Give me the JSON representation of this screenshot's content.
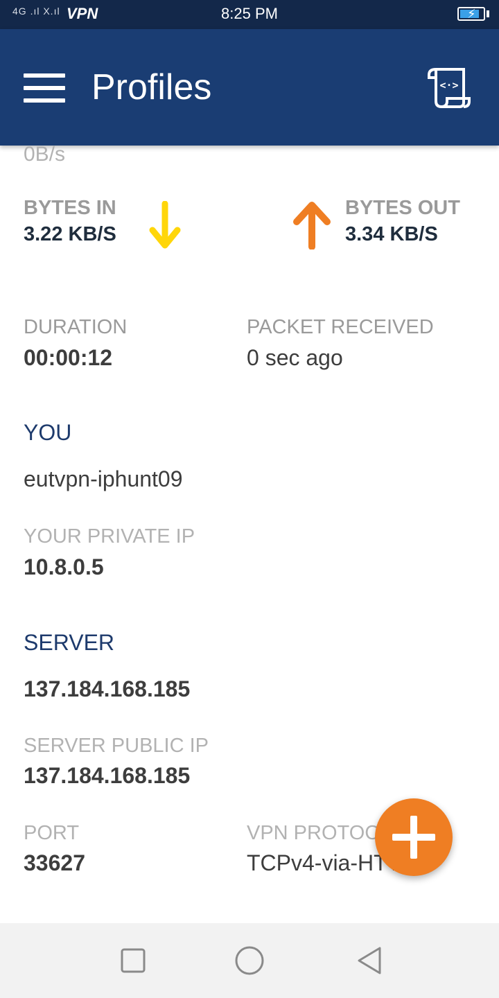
{
  "status_bar": {
    "signal_text": "4G .ıl X.ıl",
    "vpn_label": "VPN",
    "time": "8:25 PM",
    "battery_level": 0.85
  },
  "app_bar": {
    "title": "Profiles",
    "menu_icon": "hamburger-menu-icon",
    "log_icon": "log-scroll-icon"
  },
  "stats": {
    "partial_rate": "0B/s",
    "bytes_in": {
      "label": "BYTES IN",
      "value": "3.22 KB/S",
      "icon": "arrow-down-icon",
      "color": "#ffd60a"
    },
    "bytes_out": {
      "label": "BYTES OUT",
      "value": "3.34 KB/S",
      "icon": "arrow-up-icon",
      "color": "#ef7e23"
    },
    "duration": {
      "label": "DURATION",
      "value": "00:00:12"
    },
    "packet_received": {
      "label": "PACKET RECEIVED",
      "value": "0 sec ago"
    }
  },
  "you": {
    "heading": "YOU",
    "username": "eutvpn-iphunt09",
    "private_ip_label": "YOUR PRIVATE IP",
    "private_ip": "10.8.0.5"
  },
  "server": {
    "heading": "SERVER",
    "address": "137.184.168.185",
    "public_ip_label": "SERVER PUBLIC IP",
    "public_ip": "137.184.168.185",
    "port_label": "PORT",
    "port": "33627",
    "protocol_label": "VPN PROTOCOL",
    "protocol": "TCPv4-via-HTTP"
  },
  "fab": {
    "icon": "plus-icon"
  },
  "nav_bar": {
    "recents_icon": "square-recents-icon",
    "home_icon": "circle-home-icon",
    "back_icon": "triangle-back-icon"
  },
  "colors": {
    "app_bar": "#1a3d73",
    "status_bar": "#13284a",
    "accent": "#ef7e23",
    "section_heading": "#1d3a6c"
  }
}
